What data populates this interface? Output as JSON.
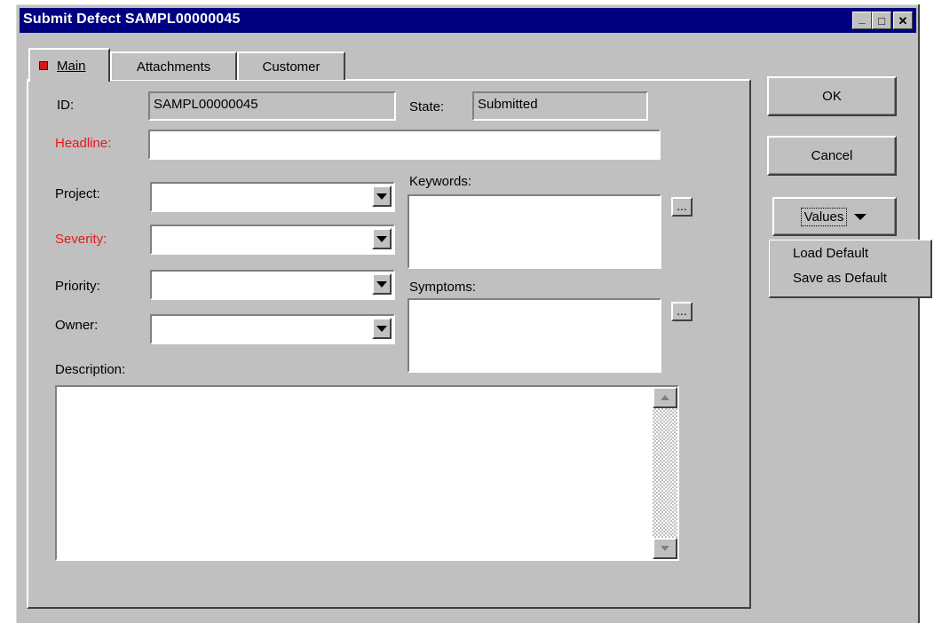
{
  "window": {
    "title": "Submit Defect SAMPL00000045",
    "controls": {
      "minimize": "_",
      "maximize": "□",
      "close": "✕"
    }
  },
  "tabs": [
    {
      "label": "Main",
      "active": true,
      "indicator_color": "#d81818"
    },
    {
      "label": "Attachments",
      "active": false
    },
    {
      "label": "Customer",
      "active": false
    }
  ],
  "form": {
    "id_label": "ID:",
    "id_value": "SAMPL00000045",
    "state_label": "State:",
    "state_value": "Submitted",
    "headline_label": "Headline:",
    "headline_value": "",
    "project_label": "Project:",
    "project_value": "",
    "severity_label": "Severity:",
    "severity_value": "",
    "priority_label": "Priority:",
    "priority_value": "",
    "owner_label": "Owner:",
    "owner_value": "",
    "keywords_label": "Keywords:",
    "keywords_value": "",
    "symptoms_label": "Symptoms:",
    "symptoms_value": "",
    "description_label": "Description:",
    "description_value": "",
    "ellipsis": "..."
  },
  "buttons": {
    "ok": "OK",
    "cancel": "Cancel",
    "values": "Values"
  },
  "values_menu": {
    "items": [
      "Load Default",
      "Save as Default"
    ]
  },
  "colors": {
    "titlebar": "#000080",
    "required_label": "#e81818",
    "face": "#c0c0c0"
  }
}
